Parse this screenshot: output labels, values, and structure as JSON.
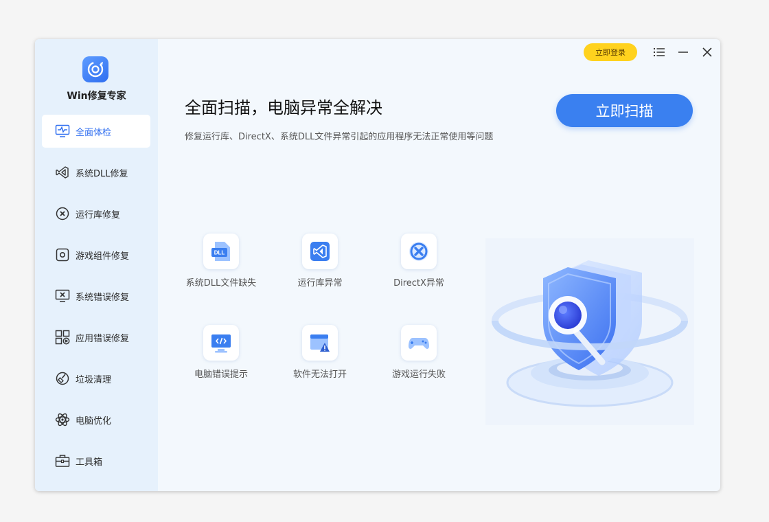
{
  "app": {
    "name": "Win修复专家"
  },
  "titlebar": {
    "login_label": "立即登录",
    "menu_icon": "list-menu-icon",
    "minimize_icon": "minimize-icon",
    "close_icon": "close-icon"
  },
  "sidebar": {
    "items": [
      {
        "label": "全面体检",
        "icon": "monitor-pulse-icon",
        "active": true
      },
      {
        "label": "系统DLL修复",
        "icon": "visual-studio-icon",
        "active": false
      },
      {
        "label": "运行库修复",
        "icon": "circle-x-icon",
        "active": false
      },
      {
        "label": "游戏组件修复",
        "icon": "gear-square-icon",
        "active": false
      },
      {
        "label": "系统错误修复",
        "icon": "monitor-x-icon",
        "active": false
      },
      {
        "label": "应用错误修复",
        "icon": "app-grid-x-icon",
        "active": false
      },
      {
        "label": "垃圾清理",
        "icon": "broom-icon",
        "active": false
      },
      {
        "label": "电脑优化",
        "icon": "atom-icon",
        "active": false
      },
      {
        "label": "工具箱",
        "icon": "toolbox-icon",
        "active": false
      }
    ]
  },
  "main": {
    "headline": "全面扫描，电脑异常全解决",
    "subline": "修复运行库、DirectX、系统DLL文件异常引起的应用程序无法正常使用等问题",
    "scan_label": "立即扫描",
    "features": [
      {
        "label": "系统DLL文件缺失",
        "icon": "dll-file-icon"
      },
      {
        "label": "运行库异常",
        "icon": "visual-studio-icon"
      },
      {
        "label": "DirectX异常",
        "icon": "directx-x-icon"
      },
      {
        "label": "电脑错误提示",
        "icon": "monitor-code-icon"
      },
      {
        "label": "软件无法打开",
        "icon": "window-warning-icon"
      },
      {
        "label": "游戏运行失败",
        "icon": "gamepad-icon"
      }
    ]
  },
  "colors": {
    "accent": "#3a80f0",
    "login": "#ffd21e",
    "sidebar_bg": "#e6f1fc",
    "main_bg": "#f3f8fd"
  }
}
